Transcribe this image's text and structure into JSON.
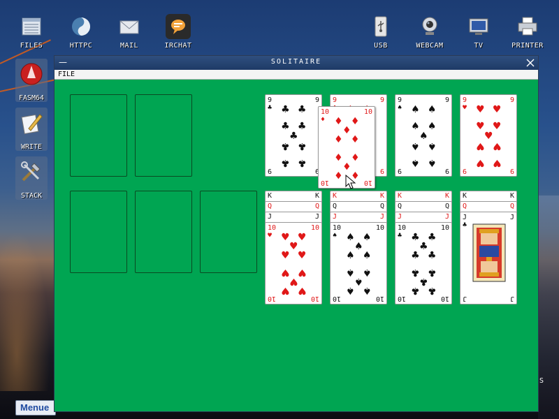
{
  "desktop": {
    "top_icons": [
      {
        "label": "FILES",
        "icon": "files-icon"
      },
      {
        "label": "HTTPC",
        "icon": "httpc-icon"
      },
      {
        "label": "MAIL",
        "icon": "mail-icon"
      },
      {
        "label": "IRCHAT",
        "icon": "irchat-icon"
      },
      {
        "label": "USB",
        "icon": "usb-icon"
      },
      {
        "label": "WEBCAM",
        "icon": "webcam-icon"
      },
      {
        "label": "TV",
        "icon": "tv-icon"
      },
      {
        "label": "PRINTER",
        "icon": "printer-icon"
      }
    ],
    "side_icons": [
      {
        "label": "FASM64",
        "icon": "fasm64-icon"
      },
      {
        "label": "WRITE",
        "icon": "write-icon"
      },
      {
        "label": "STACK",
        "icon": "stack-icon"
      }
    ],
    "taskbar_menu": "Menue",
    "partial_label": "S"
  },
  "window": {
    "title": "SOLITAIRE",
    "menu": [
      "FILE"
    ]
  },
  "cards": {
    "foundation_row": [
      {
        "rank": "9",
        "suit": "♣",
        "color": "black"
      },
      {
        "rank": "9",
        "suit": "♦",
        "color": "red"
      },
      {
        "rank": "9",
        "suit": "♠",
        "color": "black"
      },
      {
        "rank": "9",
        "suit": "♥",
        "color": "red"
      }
    ],
    "dragged": {
      "rank": "10",
      "suit": "♦",
      "color": "red"
    },
    "tableau_columns": [
      {
        "strips": [
          {
            "rank": "K",
            "suit": "♣",
            "color": "black"
          },
          {
            "rank": "Q",
            "suit": "♦",
            "color": "red"
          },
          {
            "rank": "J",
            "suit": "♣",
            "color": "black"
          }
        ],
        "top": {
          "rank": "10",
          "suit": "♥",
          "color": "red"
        }
      },
      {
        "strips": [
          {
            "rank": "K",
            "suit": "♥",
            "color": "red"
          },
          {
            "rank": "Q",
            "suit": "♣",
            "color": "black"
          },
          {
            "rank": "J",
            "suit": "♥",
            "color": "red"
          }
        ],
        "top": {
          "rank": "10",
          "suit": "♠",
          "color": "black"
        }
      },
      {
        "strips": [
          {
            "rank": "K",
            "suit": "♦",
            "color": "red"
          },
          {
            "rank": "Q",
            "suit": "♠",
            "color": "black"
          },
          {
            "rank": "J",
            "suit": "♦",
            "color": "red"
          }
        ],
        "top": {
          "rank": "10",
          "suit": "♣",
          "color": "black"
        }
      },
      {
        "strips": [
          {
            "rank": "K",
            "suit": "♠",
            "color": "black"
          },
          {
            "rank": "Q",
            "suit": "♥",
            "color": "red"
          }
        ],
        "top": {
          "rank": "J",
          "suit": "♣",
          "color": "black",
          "face": true
        }
      }
    ]
  }
}
